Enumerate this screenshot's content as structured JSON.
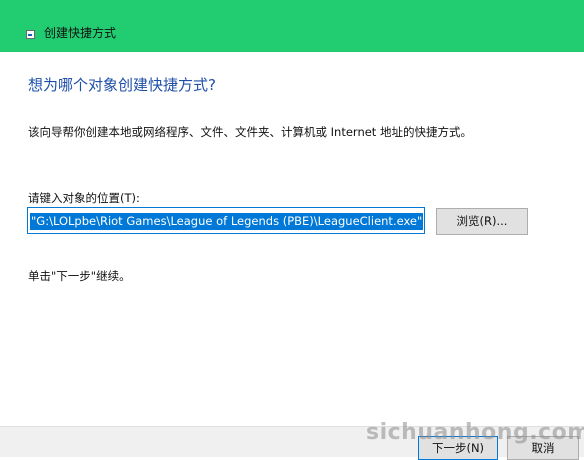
{
  "window": {
    "title": "创建快捷方式"
  },
  "main": {
    "heading": "想为哪个对象创建快捷方式?",
    "description": "该向导帮你创建本地或网络程序、文件、文件夹、计算机或 Internet 地址的快捷方式。",
    "location_label": "请键入对象的位置(T):",
    "location_value": "\"G:\\LOLpbe\\Riot Games\\League of Legends (PBE)\\LeagueClient.exe\"",
    "browse_label": "浏览(R)...",
    "hint": "单击\"下一步\"继续。"
  },
  "footer": {
    "next_label": "下一步(N)",
    "cancel_label": "取消"
  },
  "watermark": "sichuanhong.com",
  "colors": {
    "titlebar": "#22cc70",
    "heading": "#1e4fa8",
    "selection": "#0078d7"
  }
}
